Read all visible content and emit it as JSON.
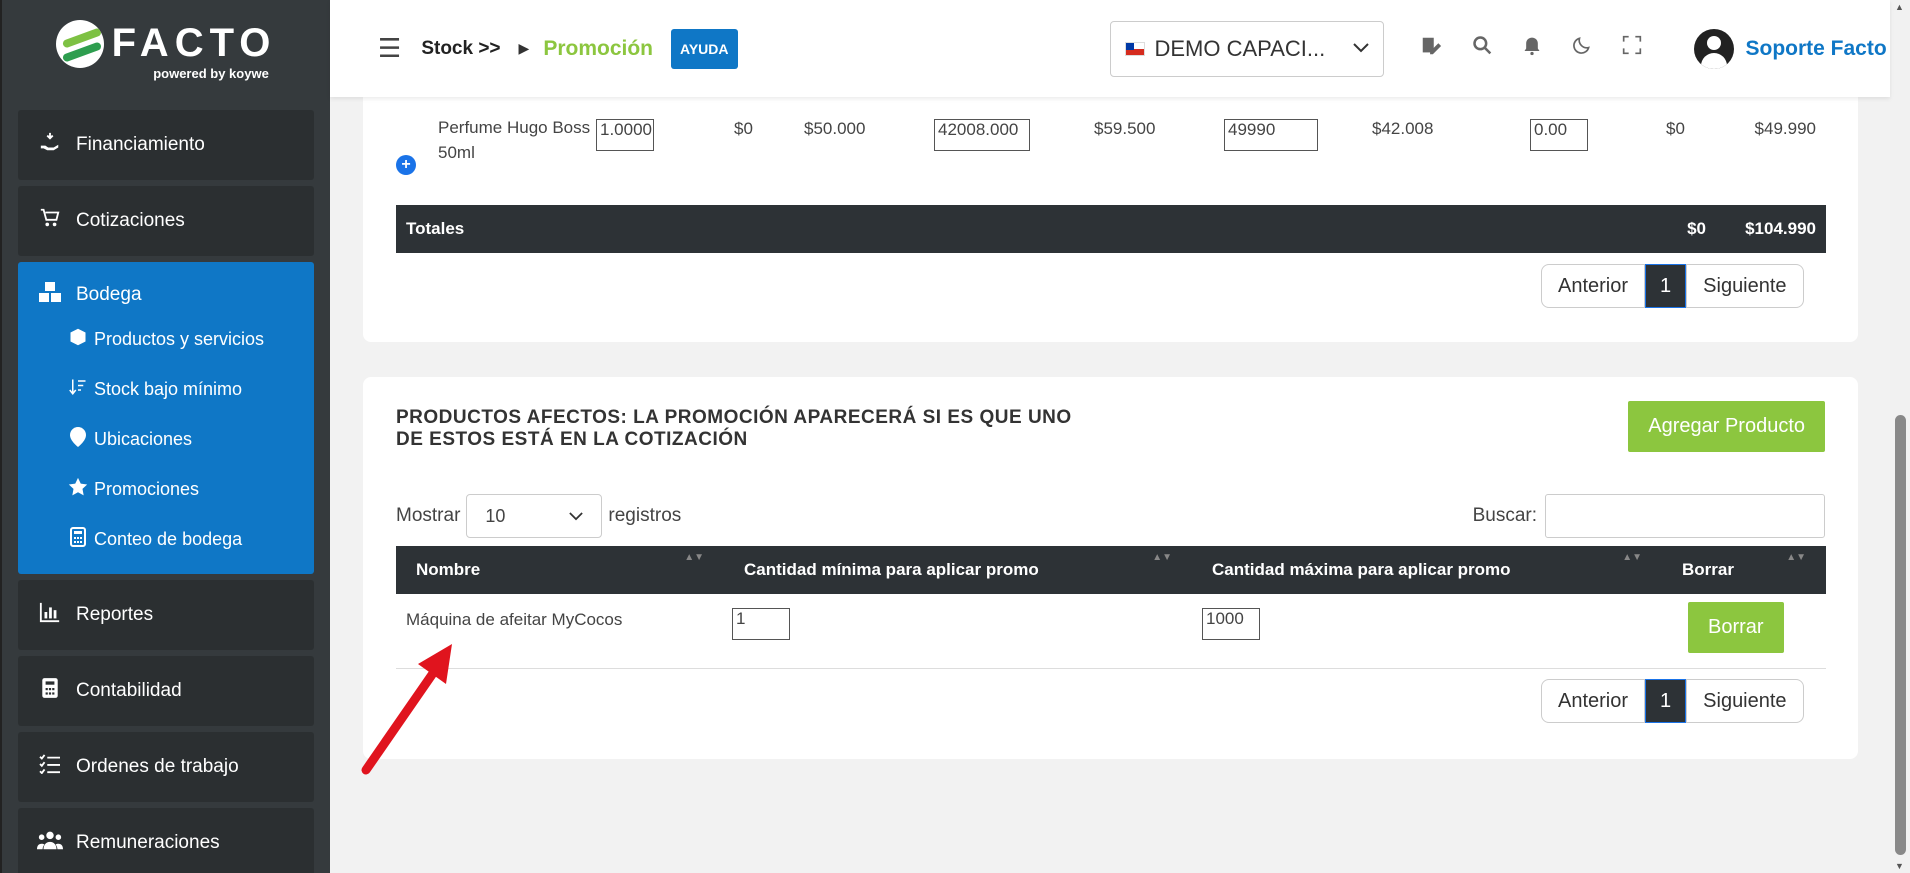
{
  "logo": {
    "name": "FACTO",
    "powered": "powered by koywe"
  },
  "sidebar": {
    "items_top": [
      {
        "label": "Financiamiento",
        "icon": "hand-money-icon"
      },
      {
        "label": "Cotizaciones",
        "icon": "cart-icon"
      }
    ],
    "group": {
      "label": "Bodega",
      "icon": "boxes-icon",
      "children": [
        {
          "label": "Productos y servicios",
          "icon": "box-icon"
        },
        {
          "label": "Stock bajo mínimo",
          "icon": "sort-down-icon"
        },
        {
          "label": "Ubicaciones",
          "icon": "map-pin-icon"
        },
        {
          "label": "Promociones",
          "icon": "star-icon"
        },
        {
          "label": "Conteo de bodega",
          "icon": "calculator-icon"
        }
      ]
    },
    "items_bottom": [
      {
        "label": "Reportes",
        "icon": "bar-chart-icon"
      },
      {
        "label": "Contabilidad",
        "icon": "calculator-icon"
      },
      {
        "label": "Ordenes de trabajo",
        "icon": "list-check-icon"
      },
      {
        "label": "Remuneraciones",
        "icon": "users-icon"
      }
    ]
  },
  "header": {
    "breadcrumb_parent": "Stock >>",
    "breadcrumb_current": "Promoción",
    "help_label": "AYUDA",
    "company": "DEMO CAPACI...",
    "user_name": "Soporte Facto"
  },
  "top_table": {
    "row": {
      "product": "Perfume Hugo Boss 50ml",
      "qty": "1.0000",
      "discount": "$0",
      "price": "$50.000",
      "cost_input": "42008.000",
      "total_price": "$59.500",
      "final_input": "49990",
      "net": "$42.008",
      "tax_input": "0.00",
      "tax": "$0",
      "total": "$49.990"
    },
    "totals_label": "Totales",
    "totals_tax": "$0",
    "totals_sum": "$104.990"
  },
  "pager": {
    "prev": "Anterior",
    "page": "1",
    "next": "Siguiente"
  },
  "affected": {
    "title": "PRODUCTOS AFECTOS: LA PROMOCIÓN APARECERÁ SI ES QUE UNO DE ESTOS ESTÁ EN LA COTIZACIÓN",
    "add_label": "Agregar Producto",
    "show_label": "Mostrar",
    "show_value": "10",
    "records_label": "registros",
    "search_label": "Buscar:",
    "columns": [
      "Nombre",
      "Cantidad mínima para aplicar promo",
      "Cantidad máxima para aplicar promo",
      "Borrar"
    ],
    "row": {
      "name": "Máquina de afeitar MyCocos",
      "min": "1",
      "max": "1000",
      "delete_label": "Borrar"
    }
  },
  "colors": {
    "accent_green": "#8cc63f",
    "accent_blue": "#0f77c6",
    "dark": "#2d3236",
    "arrow_red": "#e0141e"
  }
}
